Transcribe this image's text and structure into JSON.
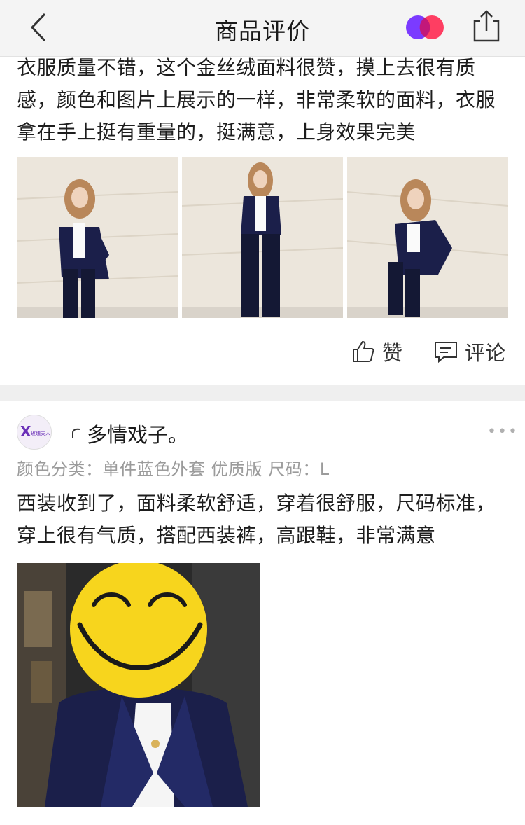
{
  "header": {
    "title": "商品评价",
    "back_icon": "chevron-left-icon",
    "share_icon": "share-icon",
    "logo_colors": [
      "#7b3bff",
      "#ff2a52"
    ]
  },
  "review1": {
    "text": "衣服质量不错，这个金丝绒面料很赞，摸上去很有质感，颜色和图片上展示的一样，非常柔软的面料，衣服拿在手上挺有重量的，挺满意，上身效果完美",
    "photos": [
      "photo-1",
      "photo-2",
      "photo-3"
    ],
    "like_label": "赞",
    "comment_label": "评论"
  },
  "review2": {
    "avatar_text": "玫瑰夫人",
    "username": "多情戏子。",
    "more_label": "•••",
    "meta": "颜色分类：单件蓝色外套  优质版  尺码：L",
    "text": "西装收到了，面料柔软舒适，穿着很舒服，尺码标准，穿上很有气质，搭配西装裤，高跟鞋，非常满意"
  },
  "colors": {
    "text": "#1d1d1d",
    "meta": "#9b9b9b",
    "divider": "#efefef",
    "jacket": "#1b1f4a",
    "emoji": "#f7d51d"
  }
}
